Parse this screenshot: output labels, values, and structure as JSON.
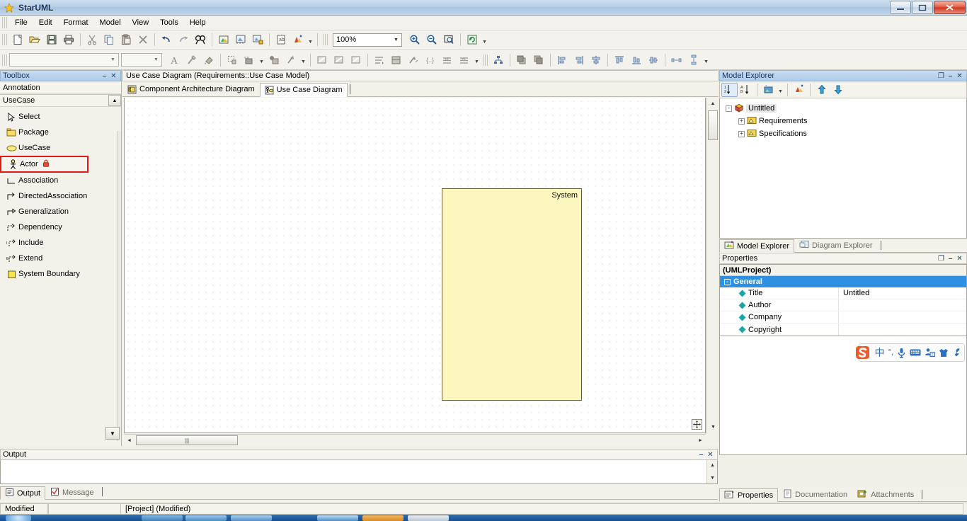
{
  "window": {
    "title": "StarUML",
    "minimize_label": "–",
    "maximize_label": "❐",
    "close_label": "✕"
  },
  "menubar": {
    "items": [
      {
        "label": "File"
      },
      {
        "label": "Edit"
      },
      {
        "label": "Format"
      },
      {
        "label": "Model"
      },
      {
        "label": "View"
      },
      {
        "label": "Tools"
      },
      {
        "label": "Help"
      }
    ]
  },
  "toolbar_main": {
    "zoom_value": "100%",
    "buttons": [
      {
        "name": "new-file-icon"
      },
      {
        "name": "open-folder-icon"
      },
      {
        "name": "save-icon"
      },
      {
        "name": "print-icon"
      },
      {
        "name": "cut-icon"
      },
      {
        "name": "copy-icon"
      },
      {
        "name": "paste-icon"
      },
      {
        "name": "delete-icon"
      },
      {
        "name": "undo-icon"
      },
      {
        "name": "redo-icon"
      },
      {
        "name": "find-icon"
      },
      {
        "name": "model-icon"
      },
      {
        "name": "diagram-icon"
      },
      {
        "name": "lock-diagram-icon"
      },
      {
        "name": "documentation-icon"
      },
      {
        "name": "profile-icon"
      },
      {
        "name": "zoom-in-icon"
      },
      {
        "name": "zoom-out-icon"
      },
      {
        "name": "fit-window-icon"
      },
      {
        "name": "refresh-icon"
      }
    ]
  },
  "toolbar_format": {
    "font_value": "",
    "size_value": "",
    "buttons": [
      {
        "name": "font-color-icon"
      },
      {
        "name": "line-style-icon"
      },
      {
        "name": "fill-color-icon"
      },
      {
        "name": "shape-icon"
      },
      {
        "name": "stereotype-icon"
      },
      {
        "name": "fill-icon"
      },
      {
        "name": "line-arrow-icon"
      },
      {
        "name": "suppress-attributes-icon"
      },
      {
        "name": "suppress-operations-icon"
      },
      {
        "name": "suppress-literals-icon"
      },
      {
        "name": "word-wrap-icon"
      },
      {
        "name": "show-compartment-icon"
      },
      {
        "name": "show-visibility-icon"
      },
      {
        "name": "show-namespace-icon"
      },
      {
        "name": "show-property-icon"
      },
      {
        "name": "show-type-icon"
      },
      {
        "name": "auto-resize-icon"
      },
      {
        "name": "layout-diagram-icon"
      },
      {
        "name": "bring-to-front-icon"
      },
      {
        "name": "send-to-back-icon"
      },
      {
        "name": "align-left-icon"
      },
      {
        "name": "align-center-icon"
      },
      {
        "name": "align-right-icon"
      },
      {
        "name": "align-top-icon"
      },
      {
        "name": "align-middle-icon"
      },
      {
        "name": "align-bottom-icon"
      },
      {
        "name": "space-horizontally-icon"
      },
      {
        "name": "space-vertically-icon"
      }
    ]
  },
  "toolbox": {
    "header_title": "Toolbox",
    "pin_glyph": "⎯",
    "close_glyph": "✕",
    "groups": [
      {
        "label": "Annotation"
      },
      {
        "label": "UseCase"
      }
    ],
    "collapse_glyph": "▲",
    "scroll_down_glyph": "▼",
    "items": [
      {
        "label": "Select",
        "icon": "cursor-icon",
        "selected": false
      },
      {
        "label": "Package",
        "icon": "package-icon",
        "selected": false
      },
      {
        "label": "UseCase",
        "icon": "usecase-icon",
        "selected": false
      },
      {
        "label": "Actor",
        "icon": "actor-icon",
        "selected": true,
        "locked": true
      },
      {
        "label": "Association",
        "icon": "association-icon",
        "selected": false
      },
      {
        "label": "DirectedAssociation",
        "icon": "directed-association-icon",
        "selected": false
      },
      {
        "label": "Generalization",
        "icon": "generalization-icon",
        "selected": false
      },
      {
        "label": "Dependency",
        "icon": "dependency-icon",
        "selected": false
      },
      {
        "label": "Include",
        "icon": "include-icon",
        "selected": false
      },
      {
        "label": "Extend",
        "icon": "extend-icon",
        "selected": false
      },
      {
        "label": "System Boundary",
        "icon": "system-boundary-icon",
        "selected": false
      }
    ]
  },
  "diagram": {
    "title": "Use Case Diagram (Requirements::Use Case Model)",
    "tabs": [
      {
        "label": "Component Architecture Diagram",
        "icon": "component-diagram-icon",
        "active": false
      },
      {
        "label": "Use Case Diagram",
        "icon": "usecase-diagram-icon",
        "active": true
      }
    ],
    "canvas": {
      "system_boundary_label": "System",
      "pan_icon": "pan-move-icon"
    },
    "scroll": {
      "up_glyph": "▲",
      "down_glyph": "▼",
      "left_glyph": "◄",
      "right_glyph": "►"
    }
  },
  "model_explorer": {
    "header_title": "Model Explorer",
    "restore_glyph": "❐",
    "pin_glyph": "⎯",
    "close_glyph": "✕",
    "toolbar": [
      {
        "name": "sort-by-order-icon",
        "pressed": true
      },
      {
        "name": "sort-alphabetically-icon",
        "pressed": false
      },
      {
        "name": "filter-icon",
        "pressed": false
      },
      {
        "name": "select-in-diagram-icon",
        "pressed": false
      },
      {
        "name": "move-up-icon",
        "pressed": false
      },
      {
        "name": "move-down-icon",
        "pressed": false
      }
    ],
    "tree": [
      {
        "label": "Untitled",
        "level": 1,
        "expander": "-",
        "icon": "project-icon",
        "selected": true
      },
      {
        "label": "Requirements",
        "level": 2,
        "expander": "+",
        "icon": "model-folder-icon",
        "selected": false
      },
      {
        "label": "Specifications",
        "level": 2,
        "expander": "+",
        "icon": "model-folder-icon",
        "selected": false
      }
    ],
    "tabs": [
      {
        "label": "Model Explorer",
        "icon": "model-explorer-icon",
        "active": true
      },
      {
        "label": "Diagram Explorer",
        "icon": "diagram-explorer-icon",
        "active": false
      }
    ]
  },
  "properties": {
    "header_title": "Properties",
    "restore_glyph": "❐",
    "pin_glyph": "⎯",
    "close_glyph": "✕",
    "object_label": "(UMLProject)",
    "category": "General",
    "category_expander": "-",
    "rows": [
      {
        "name": "Title",
        "value": "Untitled"
      },
      {
        "name": "Author",
        "value": ""
      },
      {
        "name": "Company",
        "value": ""
      },
      {
        "name": "Copyright",
        "value": ""
      }
    ],
    "tabs": [
      {
        "label": "Properties",
        "icon": "properties-icon",
        "active": true
      },
      {
        "label": "Documentation",
        "icon": "documentation-icon",
        "active": false
      },
      {
        "label": "Attachments",
        "icon": "attachments-icon",
        "active": false
      }
    ]
  },
  "ime": {
    "logo": "sogou-logo-icon",
    "mode_label": "中",
    "punctuation_label": "°,",
    "icons": [
      {
        "name": "microphone-icon"
      },
      {
        "name": "keyboard-icon"
      },
      {
        "name": "user-panel-icon"
      },
      {
        "name": "skin-icon"
      },
      {
        "name": "toolbox-wrench-icon"
      }
    ]
  },
  "output": {
    "header_title": "Output",
    "pin_glyph": "⎯",
    "close_glyph": "✕",
    "content": "",
    "tabs": [
      {
        "label": "Output",
        "icon": "output-icon",
        "active": true
      },
      {
        "label": "Message",
        "icon": "message-icon",
        "active": false
      }
    ]
  },
  "statusbar": {
    "state": "Modified",
    "secondary": "",
    "project": "[Project]  (Modified)"
  }
}
